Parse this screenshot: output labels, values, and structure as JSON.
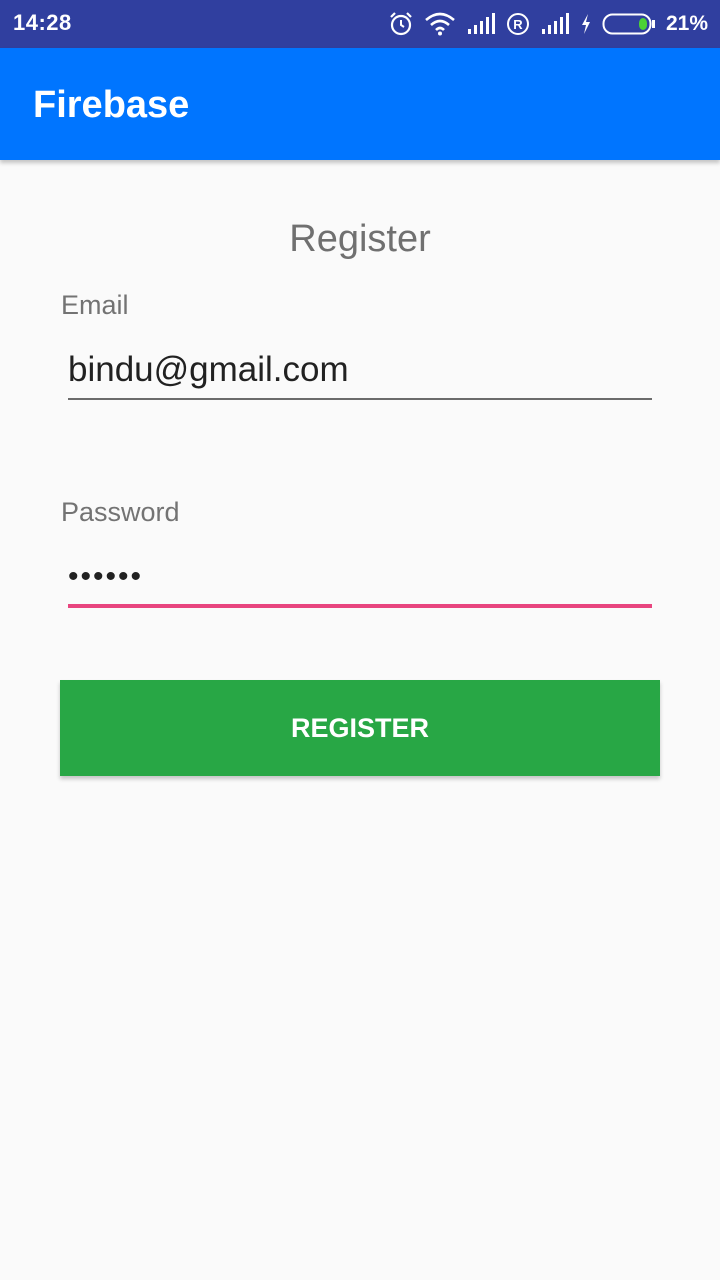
{
  "status_bar": {
    "time": "14:28",
    "battery_percent": "21%",
    "battery_level": 0.21,
    "icons": [
      "alarm-icon",
      "wifi-icon",
      "signal-icon",
      "roaming-icon",
      "signal-icon",
      "charging-icon",
      "battery-icon"
    ]
  },
  "app_bar": {
    "title": "Firebase",
    "color": "#0075ff"
  },
  "form": {
    "title": "Register",
    "email": {
      "label": "Email",
      "value": "bindu@gmail.com"
    },
    "password": {
      "label": "Password",
      "value": "••••••"
    },
    "submit_label": "REGISTER",
    "submit_color": "#28a745",
    "focus_underline_color": "#e8457f"
  }
}
